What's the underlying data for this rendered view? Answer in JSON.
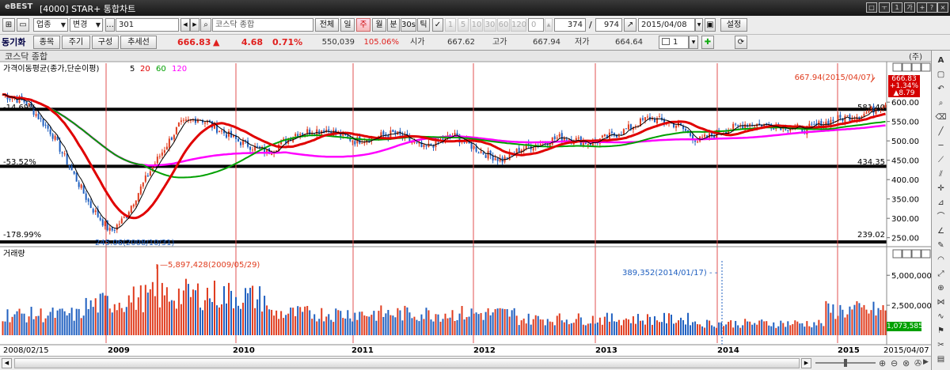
{
  "window": {
    "logo": "eBEST",
    "title": "[4000] STAR+ 통합차트"
  },
  "toolbar": {
    "market_select": "업종",
    "change_button": "변경",
    "code": "301",
    "name": "코스닥 종합",
    "period_buttons": [
      "전체",
      "일",
      "주",
      "월",
      "분",
      "30s",
      "틱"
    ],
    "active_period": "주",
    "count_buttons": [
      "1",
      "5",
      "10",
      "30",
      "60",
      "120"
    ],
    "count_start": "0",
    "view_count": "374",
    "total_count": "974",
    "date": "2015/04/08",
    "settings_button": "설정"
  },
  "toolbar2": {
    "sync_label": "동기화",
    "btn_item": "종목",
    "btn_period": "주기",
    "btn_compose": "구성",
    "btn_trend": "추세선",
    "price": "666.83",
    "change_arrow": "▲",
    "change": "4.68",
    "change_pct": "0.71%",
    "volume": "550,039",
    "vol_ratio": "105.06%",
    "open_label": "시가",
    "open": "667.62",
    "high_label": "고가",
    "high": "667.94",
    "low_label": "저가",
    "low": "664.64",
    "layout_num": "1"
  },
  "price_panel": {
    "title": "코스닥 종합",
    "unit": "(주)",
    "ma_title": "가격이동평균(종가,단순이평)",
    "ma_periods": [
      {
        "label": "5",
        "color": "#000000"
      },
      {
        "label": "20",
        "color": "#e00000"
      },
      {
        "label": "60",
        "color": "#00a000"
      },
      {
        "label": "120",
        "color": "#ff00ff"
      }
    ],
    "pct_labels": [
      "-14.69%",
      "-53.52%",
      "-178.99%"
    ],
    "right_labels": [
      "581.40",
      "434.35",
      "239.02"
    ],
    "max_annotation": "667.94(2015/04/07)",
    "min_annotation": "245.06(2008/10/31)",
    "badge": {
      "price": "666.83",
      "pct": "+1.34%",
      "chg": "▲8.79"
    },
    "y_ticks": [
      "600.00",
      "550.00",
      "500.00",
      "450.00",
      "400.00",
      "350.00",
      "300.00",
      "250.00"
    ]
  },
  "volume_panel": {
    "title": "거래량",
    "max_annotation": "5,897,428(2009/05/29)",
    "mark_annotation": "389,352(2014/01/17)",
    "y_ticks": [
      "5,000,000",
      "2,500,000"
    ],
    "current": "1,073,585"
  },
  "x_axis": {
    "labels": [
      "2008/02/15",
      "2009",
      "2010",
      "2011",
      "2012",
      "2013",
      "2014",
      "2015",
      "2015/04/07"
    ]
  },
  "colors": {
    "up": "#e03c1e",
    "down": "#2060c0",
    "ma5": "#000000",
    "ma20": "#e00000",
    "ma60": "#00a000",
    "ma120": "#ff00ff"
  }
}
